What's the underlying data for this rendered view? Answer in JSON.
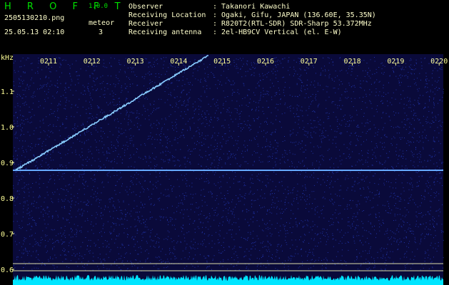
{
  "header": {
    "app_title": "H R O F F T",
    "version": "1.0.0",
    "filename": "2505130210.png",
    "timestamp": "25.05.13 02:10",
    "meteor_label": "meteor",
    "meteor_count": "3"
  },
  "info": [
    {
      "key": "Observer",
      "value": ": Takanori Kawachi"
    },
    {
      "key": "Receiving Location",
      "value": ": Ogaki, Gifu, JAPAN (136.60E, 35.35N)"
    },
    {
      "key": "Receiver",
      "value": ": R820T2(RTL-SDR) SDR-Sharp 53.372MHz"
    },
    {
      "key": "Receiving antenna",
      "value": ": 2el-HB9CV Vertical (el. E-W)"
    }
  ],
  "plot": {
    "unit_label": "kHz",
    "time_ticks": [
      "0211",
      "0212",
      "0213",
      "0214",
      "0215",
      "0216",
      "0217",
      "0218",
      "0219",
      "0220"
    ],
    "freq_ticks": [
      "1.1",
      "1.0",
      "0.9",
      "0.8",
      "0.7",
      "0.6"
    ],
    "colors": {
      "background": "#0a0a3a",
      "noise": "#3355ff",
      "carrier": "#66aaff",
      "trace": "#88ccff",
      "spectrum": "#00e5ff",
      "axis_text": "#ffff99",
      "ref_line": "#ddddaa"
    }
  }
}
